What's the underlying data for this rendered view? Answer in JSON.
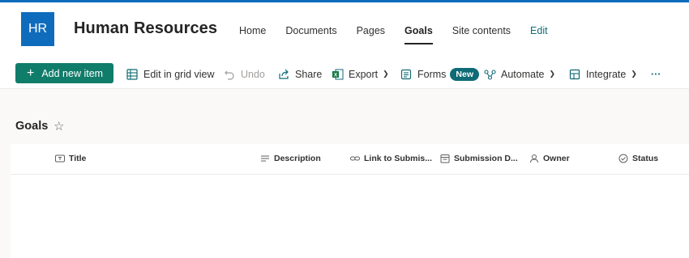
{
  "site": {
    "logo_initials": "HR",
    "title": "Human Resources",
    "nav": [
      "Home",
      "Documents",
      "Pages",
      "Goals",
      "Site contents",
      "Edit"
    ],
    "active_nav": "Goals"
  },
  "commands": {
    "add_new_item": "Add new item",
    "edit_grid": "Edit in grid view",
    "undo": "Undo",
    "share": "Share",
    "export": "Export",
    "forms": "Forms",
    "forms_badge": "New",
    "automate": "Automate",
    "integrate": "Integrate",
    "more": "···"
  },
  "list": {
    "title": "Goals",
    "columns": [
      "Title",
      "Description",
      "Link to Submis...",
      "Submission D...",
      "Owner",
      "Status"
    ]
  },
  "colors": {
    "accent_blue": "#0f6cbd",
    "primary_teal": "#107c6a",
    "badge_teal": "#0f6b75"
  }
}
